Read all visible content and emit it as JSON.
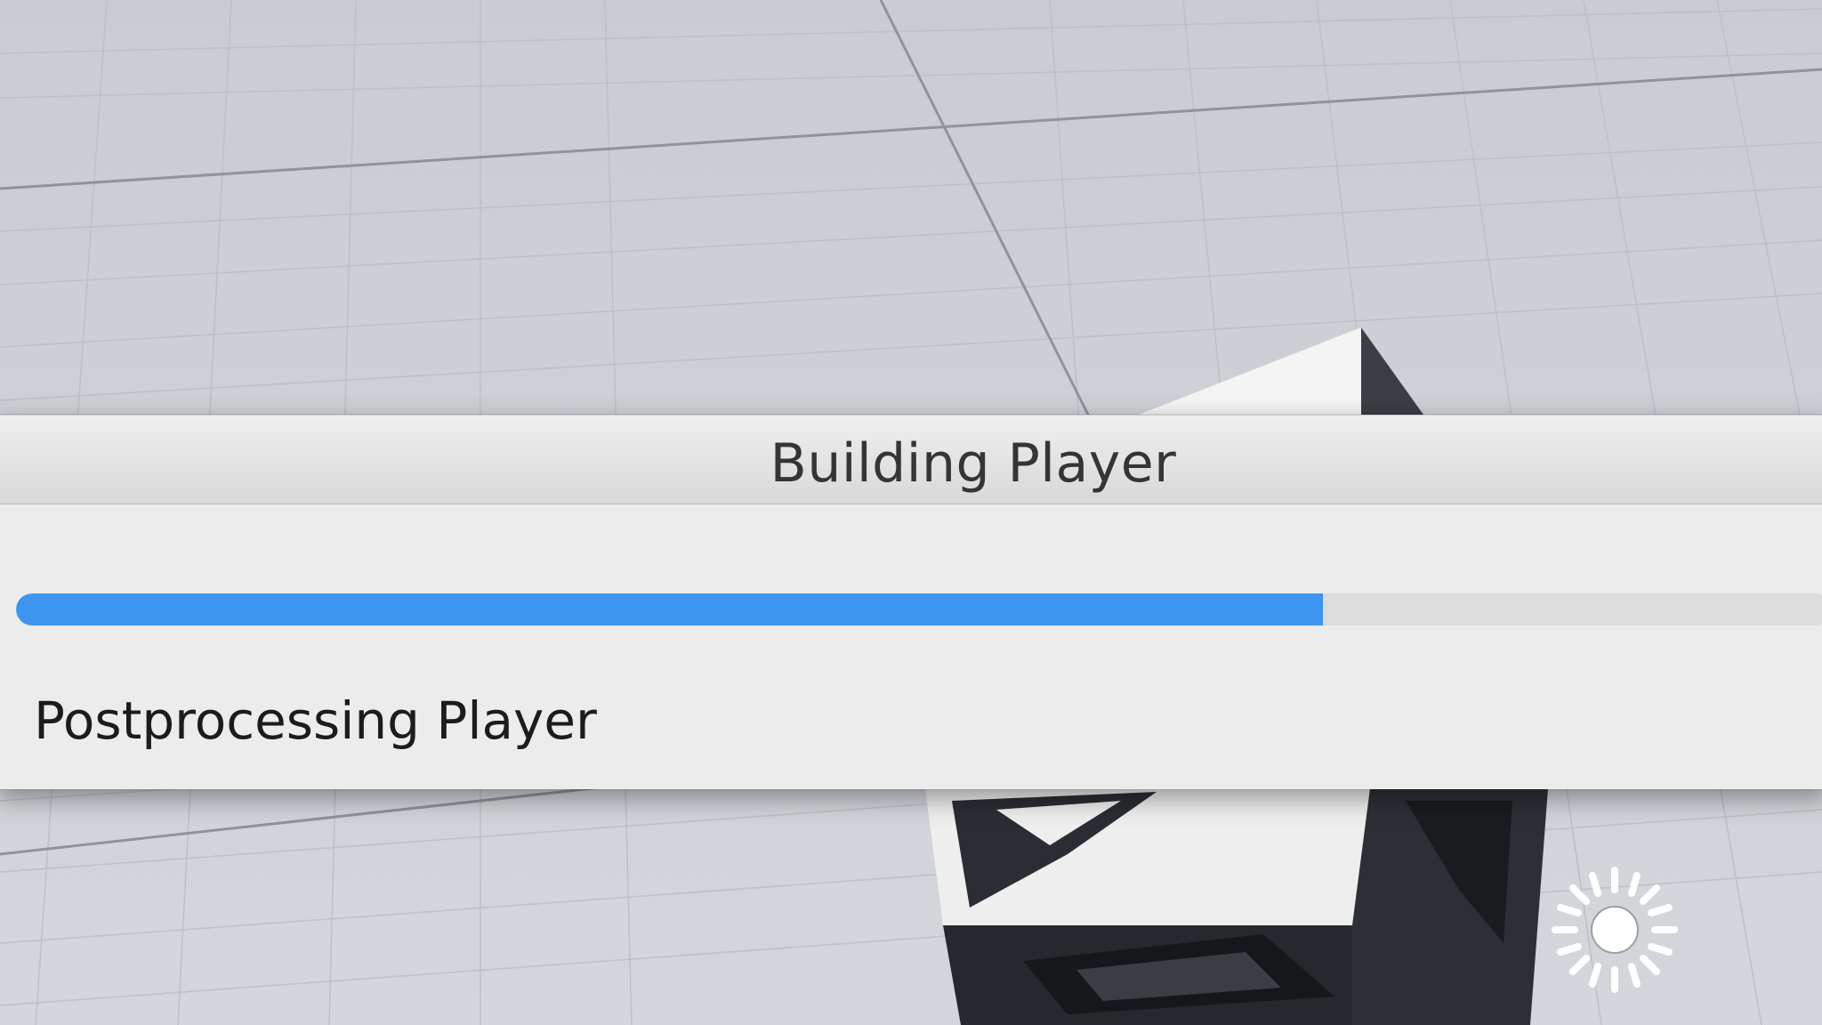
{
  "dialog": {
    "title": "Building Player",
    "status": "Postprocessing Player",
    "progress": 0.72
  },
  "colors": {
    "progress_fill": "#3d95ef",
    "progress_track": "#dcdcdc",
    "dialog_bg": "#ececec",
    "scene_bg": "#cdd1d5"
  },
  "scene": {
    "gizmo_icon": "sun-light-icon",
    "object": "cube"
  }
}
